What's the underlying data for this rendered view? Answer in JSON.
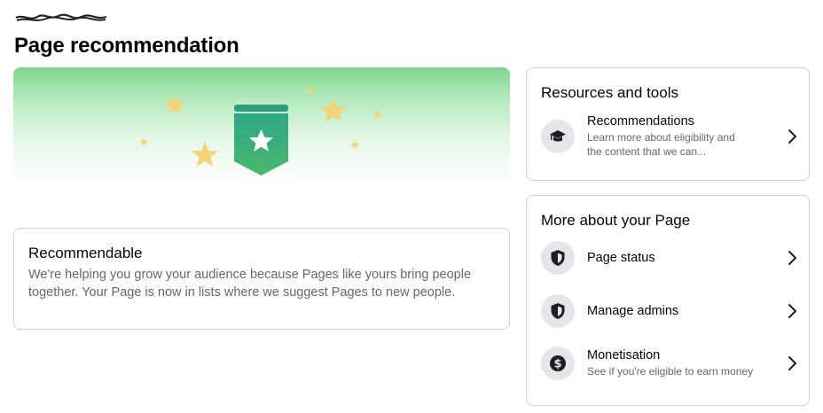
{
  "header": {
    "title": "Page recommendation"
  },
  "recommendable": {
    "title": "Recommendable",
    "description_line1": "We're helping you grow your audience because Pages like yours bring people",
    "description_line2": "together. Your Page is now in lists where we suggest Pages to new people."
  },
  "resources": {
    "title": "Resources and tools",
    "items": [
      {
        "label": "Recommendations",
        "sub_line1": "Learn more about eligibility and",
        "sub_line2": "the content that we can...",
        "icon": "graduation-cap-icon"
      }
    ]
  },
  "more_about": {
    "title": "More about your Page",
    "items": [
      {
        "label": "Page status",
        "icon": "shield-icon"
      },
      {
        "label": "Manage admins",
        "icon": "shield-icon"
      },
      {
        "label": "Monetisation",
        "sub": "See if you're eligible to earn money",
        "icon": "dollar-circle-icon"
      }
    ]
  },
  "colors": {
    "banner_green": "#7fd68f",
    "badge_green": "#3cae7c",
    "star_yellow": "#f5d37a",
    "border": "#ced0d4",
    "secondary_text": "#65676b",
    "icon_bg": "#e4e6eb"
  }
}
